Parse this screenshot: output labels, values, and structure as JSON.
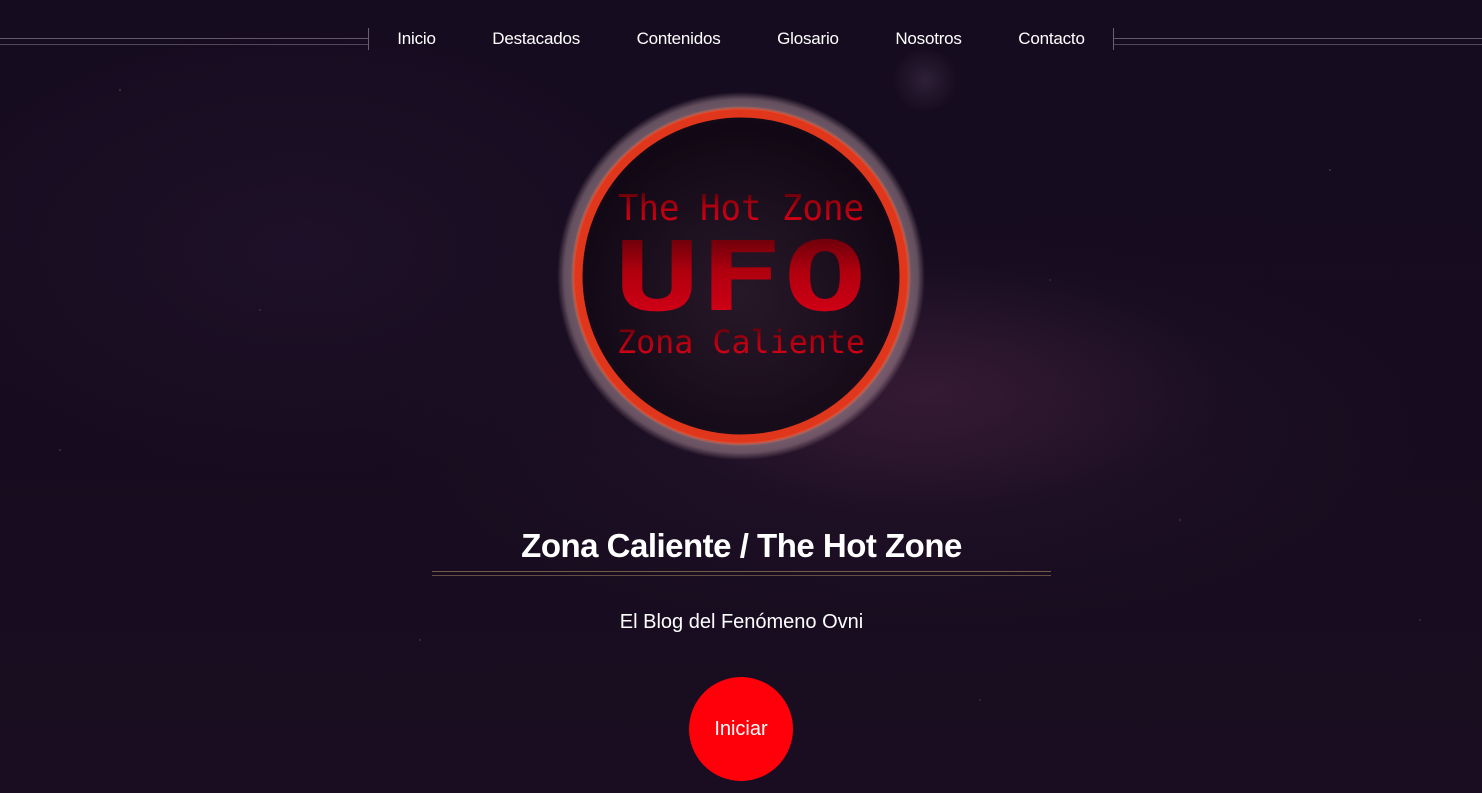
{
  "nav": {
    "items": [
      {
        "label": "Inicio"
      },
      {
        "label": "Destacados"
      },
      {
        "label": "Contenidos"
      },
      {
        "label": "Glosario"
      },
      {
        "label": "Nosotros"
      },
      {
        "label": "Contacto"
      }
    ]
  },
  "logo": {
    "line1": "The Hot Zone",
    "line2": "UFO",
    "line3": "Zona Caliente",
    "ring_color": "#e0361c",
    "text_color": "#d0000e"
  },
  "hero": {
    "title": "Zona Caliente / The Hot Zone",
    "subtitle": "El Blog del Fenómeno Ovni",
    "cta_label": "Iniciar"
  },
  "colors": {
    "background": "#160c20",
    "cta": "#ff000a",
    "text": "#ffffff"
  }
}
